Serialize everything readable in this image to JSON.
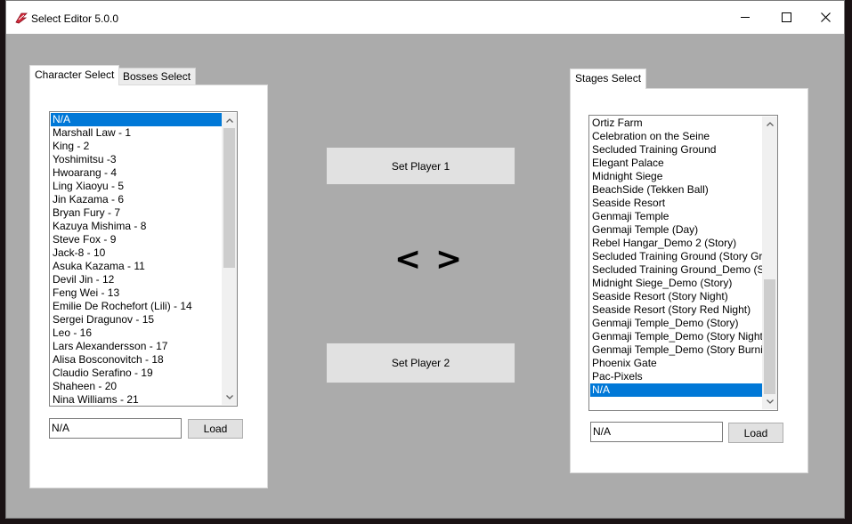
{
  "window": {
    "title": "Select Editor 5.0.0"
  },
  "character_panel": {
    "tabs": [
      "Character Select",
      "Bosses Select"
    ],
    "list": [
      "N/A",
      "Marshall Law - 1",
      "King - 2",
      "Yoshimitsu -3",
      "Hwoarang - 4",
      "Ling Xiaoyu - 5",
      "Jin Kazama - 6",
      "Bryan Fury - 7",
      "Kazuya Mishima - 8",
      "Steve Fox - 9",
      "Jack-8 - 10",
      "Asuka Kazama - 11",
      "Devil Jin - 12",
      "Feng Wei - 13",
      "Emilie De Rochefort (Lili) - 14",
      "Sergei Dragunov - 15",
      "Leo - 16",
      "Lars Alexandersson - 17",
      "Alisa Bosconovitch - 18",
      "Claudio Serafino - 19",
      "Shaheen - 20",
      "Nina Williams - 21"
    ],
    "selected_index": 0,
    "field_value": "N/A",
    "load_label": "Load"
  },
  "center": {
    "set_player1_label": "Set Player 1",
    "set_player2_label": "Set Player 2",
    "prev_label": "<",
    "next_label": ">"
  },
  "stage_panel": {
    "tab": "Stages Select",
    "list": [
      "Ortiz Farm",
      "Celebration on the Seine",
      "Secluded Training Ground",
      "Elegant Palace",
      "Midnight Siege",
      "BeachSide (Tekken Ball)",
      "Seaside Resort",
      "Genmaji Temple",
      "Genmaji Temple (Day)",
      "Rebel Hangar_Demo 2 (Story)",
      "Secluded Training Ground (Story Gre",
      "Secluded Training Ground_Demo (St",
      "Midnight Siege_Demo (Story)",
      "Seaside Resort  (Story Night)",
      "Seaside Resort  (Story Red Night)",
      "Genmaji Temple_Demo (Story)",
      "Genmaji Temple_Demo (Story Night",
      "Genmaji Temple_Demo (Story Burni",
      "Phoenix Gate",
      "Pac-Pixels",
      "N/A"
    ],
    "selected_index": 20,
    "field_value": "N/A",
    "load_label": "Load"
  },
  "icons": {
    "app": "app-logo-icon",
    "minimize": "minimize-icon",
    "maximize": "maximize-icon",
    "close": "close-icon"
  },
  "colors": {
    "accent": "#0078d7",
    "window_bg": "#ababab",
    "panel_bg": "#ffffff"
  }
}
